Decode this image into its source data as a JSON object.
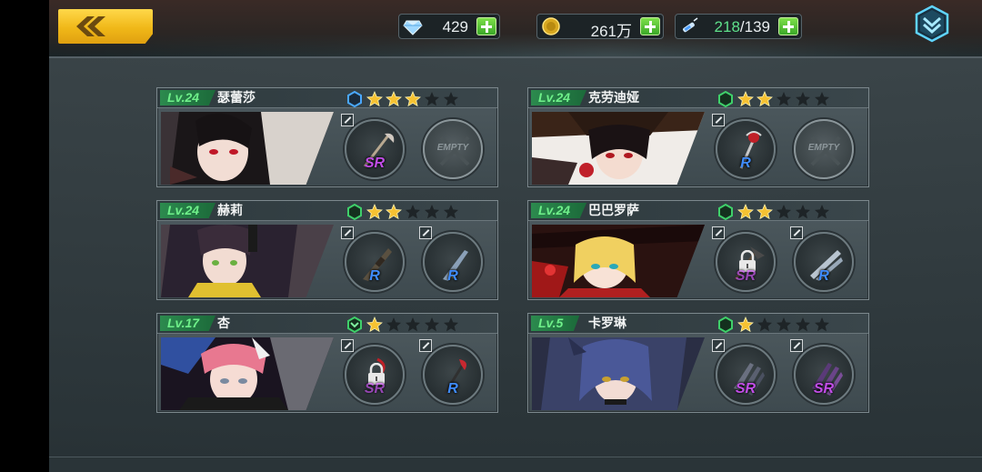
{
  "resources": {
    "diamonds": "429",
    "gold": "261万",
    "stamina_current": "218",
    "stamina_sep_max": "/139"
  },
  "slots_text": {
    "empty": "EMPTY"
  },
  "colors": {
    "accent_yellow": "#f0b818",
    "level_green": "#6ff08a",
    "rank_sr": "#c24ee8",
    "rank_r": "#3f8cff",
    "star_gold": "#f6c232"
  },
  "characters": [
    {
      "level": "Lv.24",
      "name": "瑟蕾莎",
      "class_icon": "hexagon-blue",
      "stars": 3,
      "slot1": {
        "rank": "SR",
        "weapon": "scythe-icon",
        "locked": false,
        "empty": false
      },
      "slot2": {
        "rank": "",
        "weapon": "",
        "locked": false,
        "empty": true
      }
    },
    {
      "level": "Lv.24",
      "name": "克劳迪娅",
      "class_icon": "hexagon-green",
      "stars": 2,
      "slot1": {
        "rank": "R",
        "weapon": "staff-icon",
        "locked": false,
        "empty": false
      },
      "slot2": {
        "rank": "",
        "weapon": "",
        "locked": false,
        "empty": true
      }
    },
    {
      "level": "Lv.24",
      "name": "赫莉",
      "class_icon": "hexagon-green",
      "stars": 2,
      "slot1": {
        "rank": "R",
        "weapon": "rifle-icon",
        "locked": false,
        "empty": false
      },
      "slot2": {
        "rank": "R",
        "weapon": "blade-icon",
        "locked": false,
        "empty": false
      }
    },
    {
      "level": "Lv.24",
      "name": "巴巴罗萨",
      "class_icon": "hexagon-green",
      "stars": 2,
      "slot1": {
        "rank": "SR",
        "weapon": "axe-icon",
        "locked": true,
        "empty": false
      },
      "slot2": {
        "rank": "R",
        "weapon": "twin-blades-icon",
        "locked": false,
        "empty": false
      }
    },
    {
      "level": "Lv.17",
      "name": "杏",
      "class_icon": "hexagon-chevron-green",
      "stars": 1,
      "slot1": {
        "rank": "SR",
        "weapon": "blade-red-icon",
        "locked": true,
        "empty": false
      },
      "slot2": {
        "rank": "R",
        "weapon": "sword-red-icon",
        "locked": false,
        "empty": false
      }
    },
    {
      "level": "Lv.5",
      "name": "卡罗琳",
      "class_icon": "hexagon-green",
      "stars": 1,
      "slot1": {
        "rank": "SR",
        "weapon": "claw-icon",
        "locked": false,
        "empty": false
      },
      "slot2": {
        "rank": "SR",
        "weapon": "claw-purple-icon",
        "locked": false,
        "empty": false
      }
    }
  ]
}
